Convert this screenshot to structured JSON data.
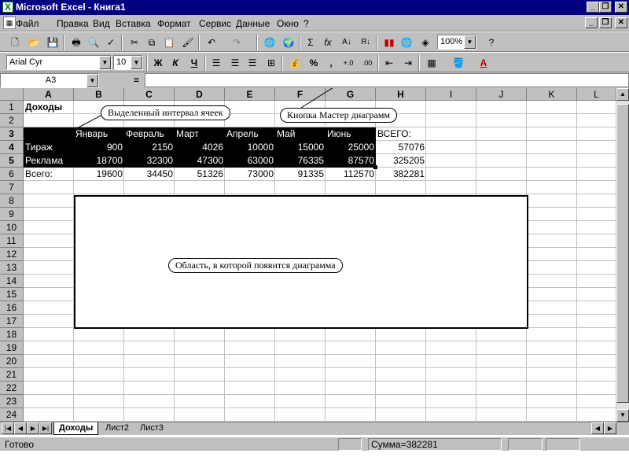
{
  "window": {
    "title": "Microsoft Excel - Книга1"
  },
  "menu": [
    "Файл",
    "Правка",
    "Вид",
    "Вставка",
    "Формат",
    "Сервис",
    "Данные",
    "Окно",
    "?"
  ],
  "toolbar": {
    "zoom": "100%",
    "font": "Arial Cyr",
    "size": "10",
    "bold": "Ж",
    "italic": "К",
    "underline": "Ч",
    "percent": "%",
    "comma": ",",
    "sigma": "Σ",
    "fx": "fx"
  },
  "name_box": "A3",
  "formula_eq": "=",
  "columns": [
    "A",
    "B",
    "C",
    "D",
    "E",
    "F",
    "G",
    "H",
    "I",
    "J",
    "K",
    "L"
  ],
  "rows": [
    "1",
    "2",
    "3",
    "4",
    "5",
    "6",
    "7",
    "8",
    "9",
    "10",
    "11",
    "12",
    "13",
    "14",
    "15",
    "16",
    "17",
    "18",
    "19",
    "20",
    "21",
    "22",
    "23",
    "24"
  ],
  "cells": {
    "title": "Доходы",
    "months": [
      "Январь",
      "Февраль",
      "Март",
      "Апрель",
      "Май",
      "Июнь"
    ],
    "total_header": "ВСЕГО:",
    "row4_label": "Тираж",
    "row4": [
      "900",
      "2150",
      "4026",
      "10000",
      "15000",
      "25000"
    ],
    "row4_total": "57076",
    "row5_label": "Реклама",
    "row5": [
      "18700",
      "32300",
      "47300",
      "63000",
      "76335",
      "87570"
    ],
    "row5_total": "325205",
    "row6_label": "Всего:",
    "row6": [
      "19600",
      "34450",
      "51326",
      "73000",
      "91335",
      "112570"
    ],
    "row6_total": "382281"
  },
  "callouts": {
    "selected": "Выделенный интервал ячеек",
    "wizard": "Кнопка Мастер диаграмм",
    "area": "Область, в которой появится диаграмма"
  },
  "sheets": [
    "Доходы",
    "Лист2",
    "Лист3"
  ],
  "status": {
    "ready": "Готово",
    "sum": "Сумма=382281"
  }
}
